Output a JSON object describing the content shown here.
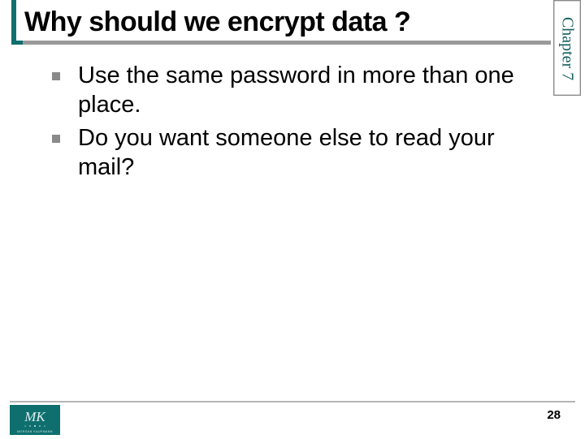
{
  "title": "Why should we encrypt data ?",
  "chapter_label": "Chapter 7",
  "bullets": {
    "item0": "Use the same password in more than one place.",
    "item1": "Do you want someone else to read your mail?"
  },
  "page_number": "28",
  "logo_initials": "MK",
  "logo_subtext": "MORGAN KAUFMANN",
  "colors": {
    "teal": "#0f6f6f",
    "rule_gray": "#9a9a9a",
    "bullet_gray": "#8a8a8a"
  }
}
